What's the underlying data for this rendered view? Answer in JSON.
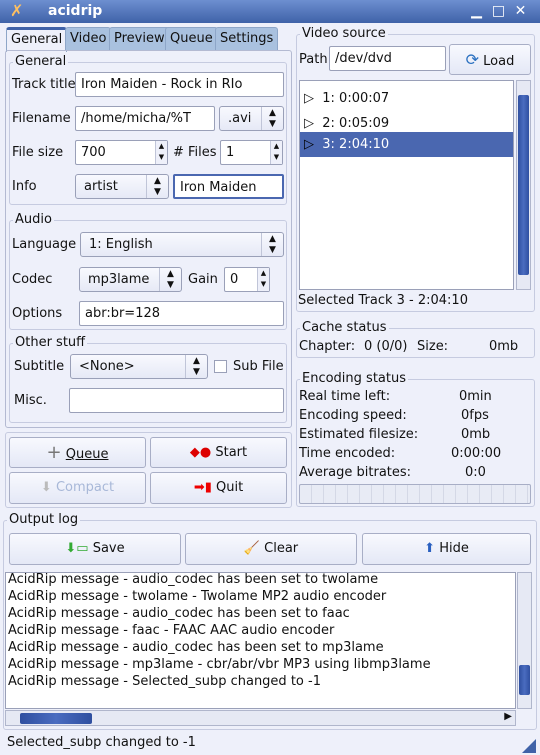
{
  "window": {
    "title": "acidrip",
    "icon": "acidrip-logo-icon"
  },
  "tabs": [
    "General",
    "Video",
    "Preview",
    "Queue",
    "Settings"
  ],
  "general": {
    "legend": "General",
    "track_title_label": "Track title",
    "track_title": "Iron Maiden - Rock in RIo",
    "filename_label": "Filename",
    "filename": "/home/micha/%T",
    "extension": ".avi",
    "file_size_label": "File size",
    "file_size": "700",
    "files_label": "# Files",
    "files": "1",
    "info_label": "Info",
    "info_key": "artist",
    "info_value": "Iron Maiden"
  },
  "audio": {
    "legend": "Audio",
    "language_label": "Language",
    "language": "1: English",
    "codec_label": "Codec",
    "codec": "mp3lame",
    "gain_label": "Gain",
    "gain": "0",
    "options_label": "Options",
    "options": "abr:br=128"
  },
  "other": {
    "legend": "Other stuff",
    "subtitle_label": "Subtitle",
    "subtitle": "<None>",
    "subfile_label": "Sub File",
    "subfile_checked": false,
    "misc_label": "Misc.",
    "misc": ""
  },
  "actions": {
    "queue": "Queue",
    "start": "Start",
    "compact": "Compact",
    "quit": "Quit"
  },
  "video_source": {
    "legend": "Video source",
    "path_label": "Path",
    "path": "/dev/dvd",
    "load": "Load",
    "tracks": [
      "1: 0:00:07",
      "2: 0:05:09",
      "3: 2:04:10"
    ],
    "selected_index": 2,
    "selected_text": "Selected Track 3 - 2:04:10"
  },
  "cache": {
    "legend": "Cache status",
    "chapter_label": "Chapter:",
    "chapter": "0 (0/0)",
    "size_label": "Size:",
    "size": "0mb"
  },
  "encoding": {
    "legend": "Encoding status",
    "rows": [
      {
        "label": "Real time left:",
        "value": "0min"
      },
      {
        "label": "Encoding speed:",
        "value": "0fps"
      },
      {
        "label": "Estimated filesize:",
        "value": "0mb"
      },
      {
        "label": "Time encoded:",
        "value": "0:00:00"
      },
      {
        "label": "Average bitrates:",
        "value": "0:0"
      }
    ],
    "progress": 0
  },
  "log": {
    "legend": "Output log",
    "save": "Save",
    "clear": "Clear",
    "hide": "Hide",
    "lines": [
      "AcidRip message - audio_codec has been set to twolame",
      "AcidRip message - twolame -  Twolame MP2 audio encoder",
      "AcidRip message - audio_codec has been set to faac",
      "AcidRip message - faac -  FAAC AAC audio encoder",
      "AcidRip message - audio_codec has been set to mp3lame",
      "AcidRip message - mp3lame -  cbr/abr/vbr MP3 using libmp3lame",
      "AcidRip message - Selected_subp changed to -1"
    ]
  },
  "status": "Selected_subp changed to -1",
  "colors": {
    "accent": "#4a67b0",
    "titlebar": "#3f62a8",
    "background": "#eef0fa"
  }
}
